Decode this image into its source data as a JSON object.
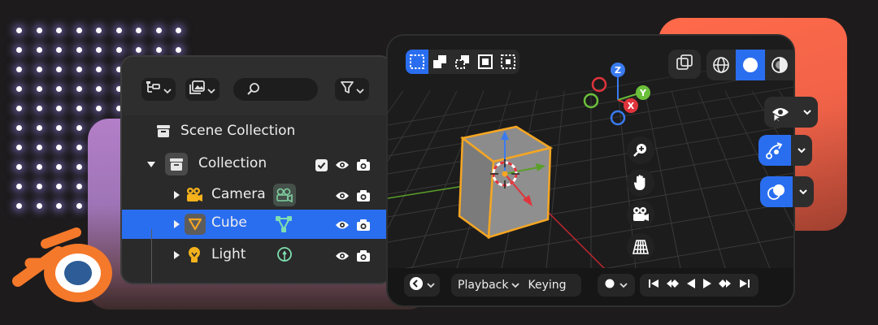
{
  "outliner": {
    "header": {
      "display_mode_icon": "outliner-tree-icon",
      "filter_icon": "funnel-icon",
      "search_placeholder": ""
    },
    "scene_collection": "Scene Collection",
    "rows": [
      {
        "label": "Collection",
        "icon": "collection-icon",
        "expanded": true,
        "checked": true
      },
      {
        "label": "Camera",
        "icon": "camera-icon",
        "data_icon": "camera-data-icon"
      },
      {
        "label": "Cube",
        "icon": "mesh-icon",
        "data_icon": "mesh-data-icon",
        "selected": true
      },
      {
        "label": "Light",
        "icon": "light-icon",
        "data_icon": "light-data-icon"
      }
    ]
  },
  "viewport": {
    "select_modes": [
      "select-box-icon",
      "select-extend-icon",
      "select-subtract-icon",
      "select-invert-icon",
      "select-intersect-icon"
    ],
    "shading_modes": [
      "wireframe-icon",
      "solid-icon",
      "material-preview-icon",
      "rendered-icon"
    ],
    "gizmo_axes": [
      "Z",
      "Y",
      "X"
    ],
    "navigation": [
      "zoom-icon",
      "pan-hand-icon",
      "camera-view-icon",
      "ortho-grid-icon"
    ],
    "side_tools": [
      "visibility-icon",
      "gizmo-icon",
      "overlay-icon"
    ]
  },
  "footer": {
    "playback_label": "Playback",
    "keying_label": "Keying"
  },
  "colors": {
    "accent": "#2a6ef0",
    "axis_x": "#e0343c",
    "axis_y": "#6bbf3a",
    "axis_z": "#3a7bf0",
    "selection": "#f5a623",
    "blender_orange": "#f5792a",
    "blender_blue": "#2d5c96"
  }
}
